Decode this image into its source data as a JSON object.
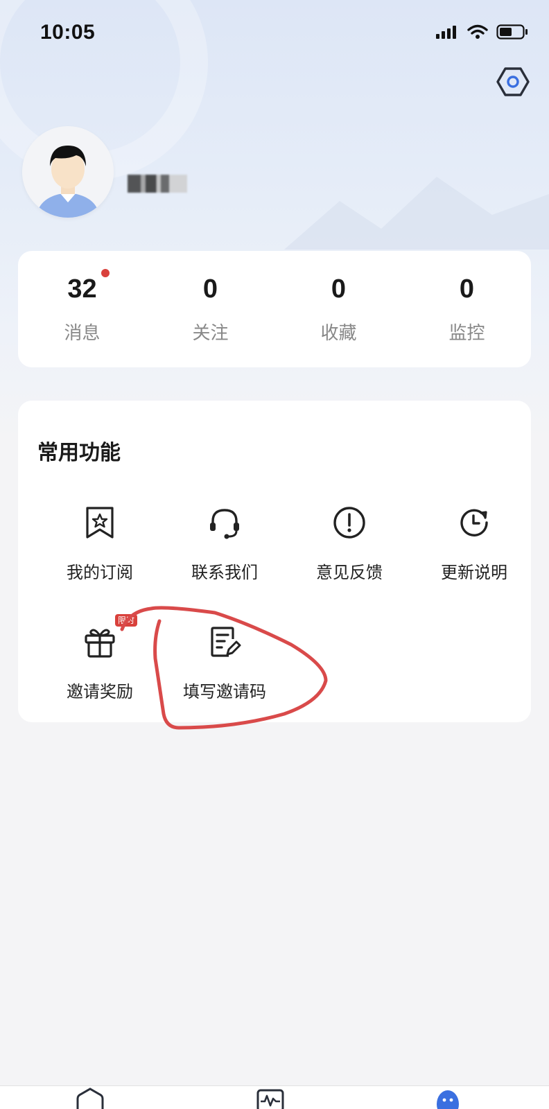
{
  "status_bar": {
    "time": "10:05"
  },
  "header": {
    "settings_icon": "settings-hexagon-icon"
  },
  "profile": {
    "avatar_icon": "user-avatar-icon"
  },
  "stats": [
    {
      "value": "32",
      "label": "消息",
      "has_dot": true
    },
    {
      "value": "0",
      "label": "关注"
    },
    {
      "value": "0",
      "label": "收藏"
    },
    {
      "value": "0",
      "label": "监控"
    }
  ],
  "functions": {
    "title": "常用功能",
    "items": [
      {
        "label": "我的订阅",
        "icon": "bookmark-star-icon"
      },
      {
        "label": "联系我们",
        "icon": "headset-icon"
      },
      {
        "label": "意见反馈",
        "icon": "exclamation-circle-icon"
      },
      {
        "label": "更新说明",
        "icon": "clock-refresh-icon"
      },
      {
        "label": "邀请奖励",
        "icon": "gift-icon",
        "badge": "限时"
      },
      {
        "label": "填写邀请码",
        "icon": "edit-note-icon"
      }
    ]
  },
  "colors": {
    "accent_red": "#d9413c",
    "tab_active": "#3a6fe0",
    "annotation": "#d94a4a"
  },
  "tabbar": {
    "icons": [
      "home-icon",
      "chart-pulse-icon",
      "profile-icon"
    ]
  }
}
